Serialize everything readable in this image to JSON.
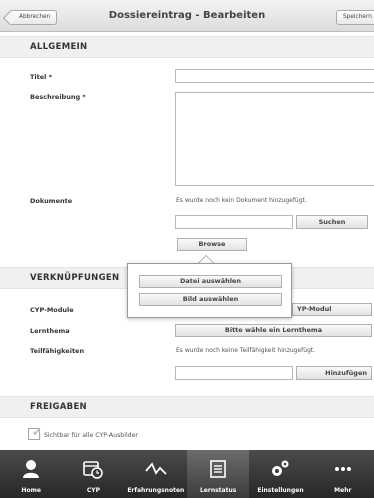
{
  "header": {
    "back_label": "Abbrechen",
    "title": "Dossiereintrag - Bearbeiten",
    "save_label": "Speichern"
  },
  "allgemein": {
    "heading": "ALLGEMEIN",
    "titel_label": "Titel *",
    "titel_value": "",
    "beschreibung_label": "Beschreibung *",
    "beschreibung_value": "",
    "dokumente_label": "Dokumente",
    "dokumente_note": "Es wurde noch kein Dokument hinzugefügt.",
    "suchen_label": "Suchen",
    "browse_label": "Browse"
  },
  "popover": {
    "file_label": "Datei auswählen",
    "image_label": "Bild auswählen"
  },
  "verknuepfungen": {
    "heading": "VERKNÜPFUNGEN",
    "module_label": "CYP-Module",
    "module_button": "YP-Modul",
    "lernthema_label": "Lernthema",
    "lernthema_button": "Bitte wähle ein Lernthema",
    "teil_label": "Teilfähigkeiten",
    "teil_note": "Es wurde noch keine Teilfähigkeit hinzugefügt.",
    "hinzufuegen_label": "Hinzufügen"
  },
  "freigaben": {
    "heading": "FREIGABEN",
    "checkbox_label": "Sichtbar für alle CYP-Ausbilder",
    "checked": true
  },
  "tabbar": {
    "active": "Lernstatus",
    "tabs": [
      {
        "label": "Home",
        "icon": "person-icon"
      },
      {
        "label": "CYP",
        "icon": "calendar-clock-icon"
      },
      {
        "label": "Erfahrungsnoten",
        "icon": "graph-icon"
      },
      {
        "label": "Lernstatus",
        "icon": "list-icon"
      },
      {
        "label": "Einstellungen",
        "icon": "gears-icon"
      },
      {
        "label": "Mehr",
        "icon": "more-icon"
      }
    ]
  }
}
